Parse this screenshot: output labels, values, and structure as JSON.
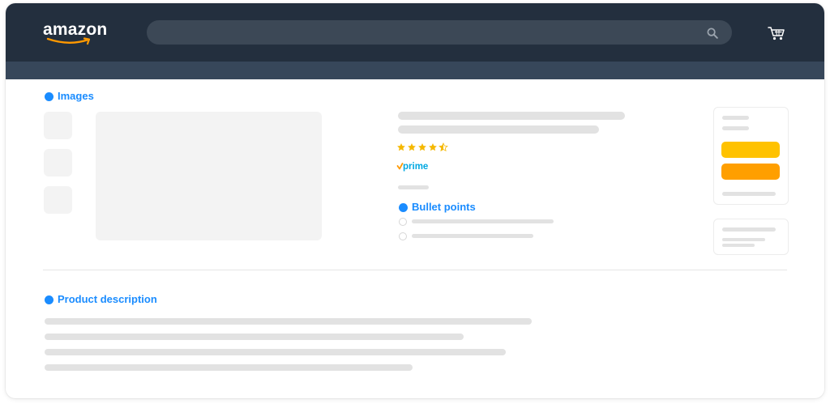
{
  "colors": {
    "header_bg": "#232f3e",
    "subnav_bg": "#37475a",
    "search_bg": "#3c4856",
    "search_icon": "#9aa3ad",
    "cart_icon": "#ffffff",
    "logo_smile": "#ff9900",
    "accent_blue": "#1a8cff",
    "label_blue": "#1a8cff",
    "placeholder": "#f3f3f3",
    "line": "#e2e2e2",
    "star": "#f5b800",
    "prime_blue": "#00a8e1",
    "prime_check": "#ff9900",
    "add_to_cart": "#ffc200",
    "buy_now": "#ff9f00",
    "divider": "#e6e6e6"
  },
  "header": {
    "logo_text": "amazon",
    "search": {
      "value": "",
      "placeholder": ""
    },
    "icons": {
      "search": "search-icon",
      "cart": "cart-icon"
    }
  },
  "sections": {
    "images": {
      "label": "Images"
    },
    "bullet_points": {
      "label": "Bullet points"
    },
    "product_description": {
      "label": "Product description"
    }
  },
  "product": {
    "rating": 4.5,
    "rating_max": 5,
    "prime_label": "prime"
  }
}
